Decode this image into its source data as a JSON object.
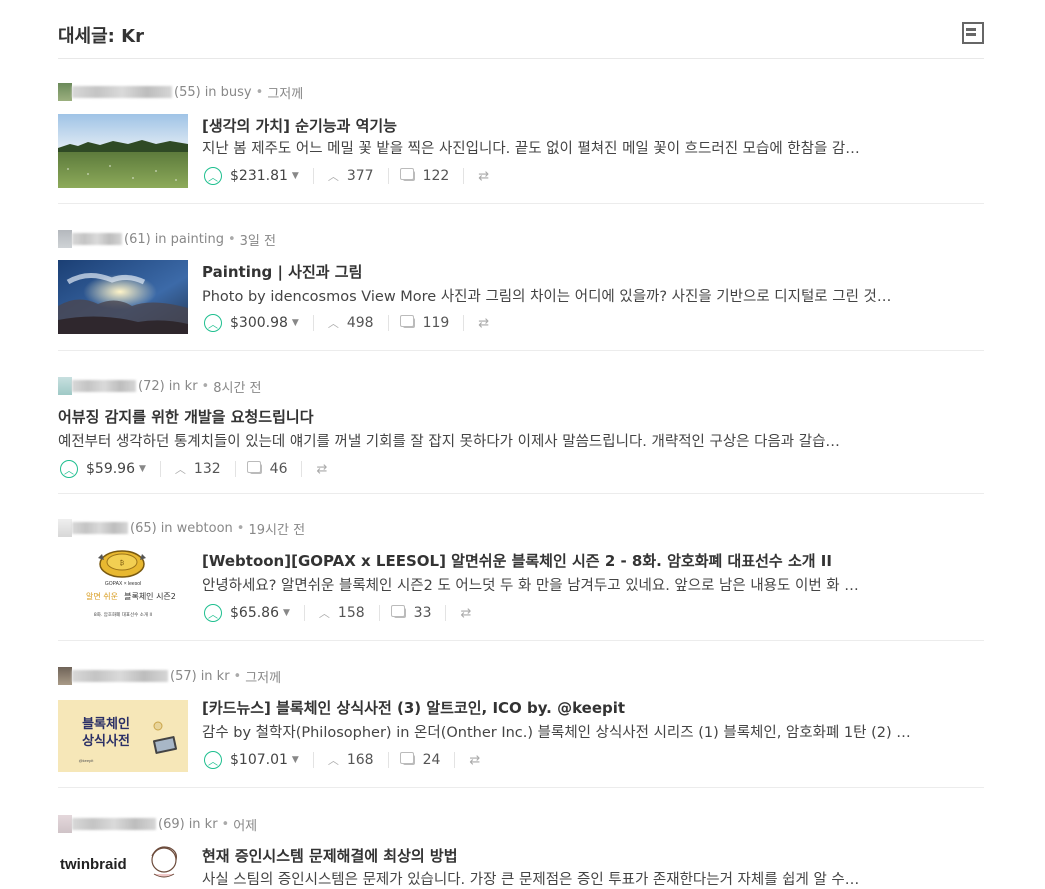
{
  "header": {
    "title": "대세글: Kr",
    "toggle_icon": "list-view-icon"
  },
  "colors": {
    "accent": "#1fbf8f",
    "text": "#333333",
    "muted": "#888888"
  },
  "posts": [
    {
      "rep": "(55)",
      "in_label": "in busy",
      "time": "그저께",
      "title": "[생각의 가치] 순기능과 역기능",
      "summary": "지난 봄 제주도 어느 메밀 꽃 밭을 찍은 사진입니다. 끝도 없이 펼쳐진 메일 꽃이 흐드러진 모습에 한참을 감…",
      "payout": "$231.81",
      "votes": "377",
      "comments": "122",
      "thumb": "meadow-photo"
    },
    {
      "rep": "(61)",
      "in_label": "in painting",
      "time": "3일 전",
      "title": "Painting | 사진과 그림",
      "summary": "Photo by idencosmos View More 사진과 그림의 차이는 어디에 있을까? 사진을 기반으로 디지털로 그린 것…",
      "payout": "$300.98",
      "votes": "498",
      "comments": "119",
      "thumb": "sky-painting"
    },
    {
      "rep": "(72)",
      "in_label": "in kr",
      "time": "8시간 전",
      "title": "어뷰징 감지를 위한 개발을 요청드립니다",
      "summary": "예전부터 생각하던 통계치들이 있는데 얘기를 꺼낼 기회를 잘 잡지 못하다가 이제사 말씀드립니다. 개략적인 구상은 다음과 갈습…",
      "payout": "$59.96",
      "votes": "132",
      "comments": "46",
      "thumb": ""
    },
    {
      "rep": "(65)",
      "in_label": "in webtoon",
      "time": "19시간 전",
      "title": "[Webtoon][GOPAX x LEESOL] 알면쉬운 블록체인 시즌 2 - 8화. 암호화폐 대표선수 소개 II",
      "summary": "안녕하세요? 알면쉬운 블록체인 시즌2 도 어느덧 두 화 만을 남겨두고 있네요. 앞으로 남은 내용도 이번 화 …",
      "payout": "$65.86",
      "votes": "158",
      "comments": "33",
      "thumb": "webtoon-coin",
      "thumb_text": {
        "brand": "GOPAX × leesol",
        "l1": "알면 쉬운",
        "l2": "블록체인 시즌2",
        "l3": "8화. 암호화폐 대표선수 소개 II"
      }
    },
    {
      "rep": "(57)",
      "in_label": "in kr",
      "time": "그저께",
      "title": "[카드뉴스] 블록체인 상식사전 (3) 알트코인, ICO by. @keepit",
      "summary": "감수 by 철학자(Philosopher) in 온더(Onther Inc.) 블록체인 상식사전 시리즈 (1) 블록체인, 암호화폐 1탄 (2) …",
      "payout": "$107.01",
      "votes": "168",
      "comments": "24",
      "thumb": "cardnews",
      "thumb_text": {
        "t1": "블록체인",
        "t2": "상식사전",
        "sub": "@keepit"
      }
    },
    {
      "rep": "(69)",
      "in_label": "in kr",
      "time": "어제",
      "title": "현재 증인시스템 문제해결에 최상의 방법",
      "summary": "사실 스팀의 증인시스템은 문제가 있습니다. 가장 큰 문제점은 증인 투표가 존재한다는거 자체를 쉽게 알 수…",
      "payout": "",
      "votes": "",
      "comments": "",
      "thumb": "twinbraid",
      "thumb_text": {
        "brand": "twinbraid"
      }
    }
  ]
}
